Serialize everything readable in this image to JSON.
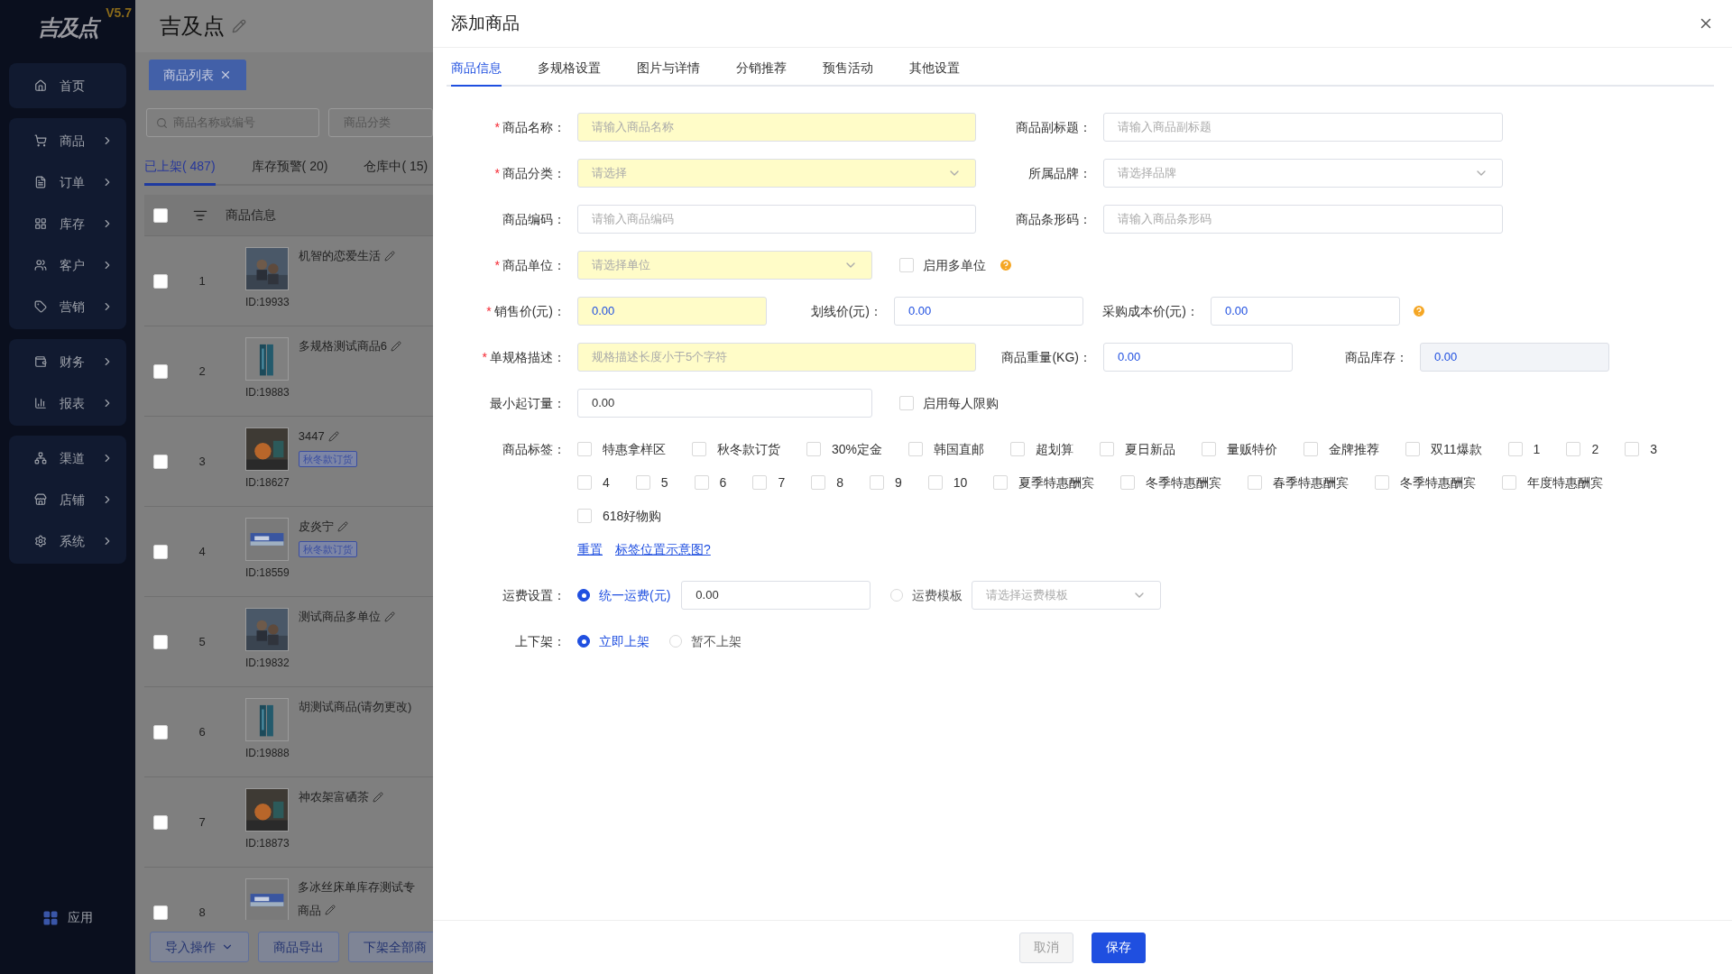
{
  "app": {
    "logo": "吉及点",
    "version": "V5.7"
  },
  "sidebar": {
    "groups": [
      [
        {
          "label": "首页",
          "expandable": false
        }
      ],
      [
        {
          "label": "商品",
          "expandable": true
        },
        {
          "label": "订单",
          "expandable": true
        },
        {
          "label": "库存",
          "expandable": true
        },
        {
          "label": "客户",
          "expandable": true
        },
        {
          "label": "营销",
          "expandable": true
        }
      ],
      [
        {
          "label": "财务",
          "expandable": true
        },
        {
          "label": "报表",
          "expandable": true
        }
      ],
      [
        {
          "label": "渠道",
          "expandable": true
        },
        {
          "label": "店铺",
          "expandable": true
        },
        {
          "label": "系统",
          "expandable": true
        }
      ]
    ],
    "footer": "应用"
  },
  "header": {
    "title": "吉及点"
  },
  "open_tabs": [
    {
      "label": "商品列表",
      "selected": true
    }
  ],
  "filters": {
    "search_placeholder": "商品名称或编号",
    "category_placeholder": "商品分类"
  },
  "status_tabs": [
    {
      "label": "已上架( 487)",
      "selected": true
    },
    {
      "label": "库存预警( 20)",
      "selected": false
    },
    {
      "label": "仓库中( 15)",
      "selected": false
    }
  ],
  "table": {
    "columns": [
      "商品信息"
    ],
    "select_all_checked": false,
    "rows": [
      {
        "index": "1",
        "checked": false,
        "name": "机智的恋爱生活",
        "id": "ID:19933"
      },
      {
        "index": "2",
        "checked": false,
        "name": "多规格测试商品6",
        "id": "ID:19883"
      },
      {
        "index": "3",
        "checked": false,
        "name": "3447",
        "id": "ID:18627",
        "tag": "秋冬款订货"
      },
      {
        "index": "4",
        "checked": false,
        "name": "皮炎宁",
        "id": "ID:18559",
        "tag": "秋冬款订货"
      },
      {
        "index": "5",
        "checked": false,
        "name": "测试商品多单位",
        "id": "ID:19832"
      },
      {
        "index": "6",
        "checked": false,
        "name": "胡测试商品(请勿更改)",
        "id": "ID:19888"
      },
      {
        "index": "7",
        "checked": false,
        "name": "神农架富硒茶",
        "id": "ID:18873"
      },
      {
        "index": "8",
        "checked": false,
        "name": "多冰丝床单库存测试专",
        "name_line2": "商品"
      }
    ]
  },
  "bottom_buttons": [
    {
      "label": "导入操作",
      "dropdown": true
    },
    {
      "label": "商品导出",
      "dropdown": false
    },
    {
      "label": "下架全部商",
      "dropdown": false
    }
  ],
  "drawer": {
    "title": "添加商品",
    "required_mark": "*",
    "tabs": [
      {
        "label": "商品信息",
        "selected": true
      },
      {
        "label": "多规格设置",
        "selected": false
      },
      {
        "label": "图片与详情",
        "selected": false
      },
      {
        "label": "分销推荐",
        "selected": false
      },
      {
        "label": "预售活动",
        "selected": false
      },
      {
        "label": "其他设置",
        "selected": false
      }
    ],
    "rows": [
      [
        {
          "kind": "input",
          "label": "商品名称：",
          "required": true,
          "placeholder": "请输入商品名称"
        },
        {
          "kind": "input",
          "label": "商品副标题：",
          "required": false,
          "placeholder": "请输入商品副标题"
        }
      ],
      [
        {
          "kind": "select",
          "label": "商品分类：",
          "required": true,
          "placeholder": "请选择"
        },
        {
          "kind": "select",
          "label": "所属品牌：",
          "required": false,
          "placeholder": "请选择品牌"
        }
      ],
      [
        {
          "kind": "input",
          "label": "商品编码：",
          "required": false,
          "placeholder": "请输入商品编码"
        },
        {
          "kind": "input",
          "label": "商品条形码：",
          "required": false,
          "placeholder": "请输入商品条形码"
        }
      ],
      [
        {
          "kind": "select",
          "label": "商品单位：",
          "required": true,
          "placeholder": "请选择单位"
        },
        {
          "kind": "checkbox",
          "label": "启用多单位",
          "checked": false,
          "help": true
        }
      ],
      [
        {
          "kind": "number",
          "label": "销售价(元)：",
          "required": true,
          "value": "0.00"
        },
        {
          "kind": "number",
          "label": "划线价(元)：",
          "required": false,
          "value": "0.00"
        },
        {
          "kind": "number",
          "label": "采购成本价(元)：",
          "required": false,
          "value": "0.00",
          "help": true
        }
      ],
      [
        {
          "kind": "input",
          "label": "单规格描述：",
          "required": true,
          "placeholder": "规格描述长度小于5个字符"
        },
        {
          "kind": "number",
          "label": "商品重量(KG)：",
          "required": false,
          "value": "0.00"
        },
        {
          "kind": "number",
          "label": "商品库存：",
          "required": false,
          "value": "0.00",
          "disabled": true
        }
      ],
      [
        {
          "kind": "input",
          "label": "最小起订量：",
          "required": false,
          "value": "0.00"
        },
        {
          "kind": "checkbox",
          "label": "启用每人限购",
          "checked": false
        }
      ]
    ],
    "tags": {
      "label": "商品标签：",
      "items": [
        {
          "label": "特惠拿样区",
          "checked": false
        },
        {
          "label": "秋冬款订货",
          "checked": false
        },
        {
          "label": "30%定金",
          "checked": false
        },
        {
          "label": "韩国直邮",
          "checked": false
        },
        {
          "label": "超划算",
          "checked": false
        },
        {
          "label": "夏日新品",
          "checked": false
        },
        {
          "label": "量贩特价",
          "checked": false
        },
        {
          "label": "金牌推荐",
          "checked": false
        },
        {
          "label": "双11爆款",
          "checked": false
        },
        {
          "label": "1",
          "checked": false
        },
        {
          "label": "2",
          "checked": false
        },
        {
          "label": "3",
          "checked": false
        },
        {
          "label": "4",
          "checked": false
        },
        {
          "label": "5",
          "checked": false
        },
        {
          "label": "6",
          "checked": false
        },
        {
          "label": "7",
          "checked": false
        },
        {
          "label": "8",
          "checked": false
        },
        {
          "label": "9",
          "checked": false
        },
        {
          "label": "10",
          "checked": false
        },
        {
          "label": "夏季特惠酬宾",
          "checked": false
        },
        {
          "label": "冬季特惠酬宾",
          "checked": false
        },
        {
          "label": "春季特惠酬宾",
          "checked": false
        },
        {
          "label": "冬季特惠酬宾",
          "checked": false
        },
        {
          "label": "年度特惠酬宾",
          "checked": false
        },
        {
          "label": "618好物购",
          "checked": false
        }
      ],
      "links": [
        "重置",
        "标签位置示意图?"
      ]
    },
    "freight": {
      "label": "运费设置：",
      "options": [
        {
          "label": "统一运费(元)",
          "selected": true,
          "value": "0.00"
        },
        {
          "label": "运费模板",
          "selected": false,
          "placeholder": "请选择运费模板"
        }
      ]
    },
    "shelf": {
      "label": "上下架：",
      "options": [
        {
          "label": "立即上架",
          "selected": true
        },
        {
          "label": "暂不上架",
          "selected": false
        }
      ]
    },
    "buttons": [
      {
        "label": "取消",
        "kind": "default"
      },
      {
        "label": "保存",
        "kind": "primary"
      }
    ]
  }
}
